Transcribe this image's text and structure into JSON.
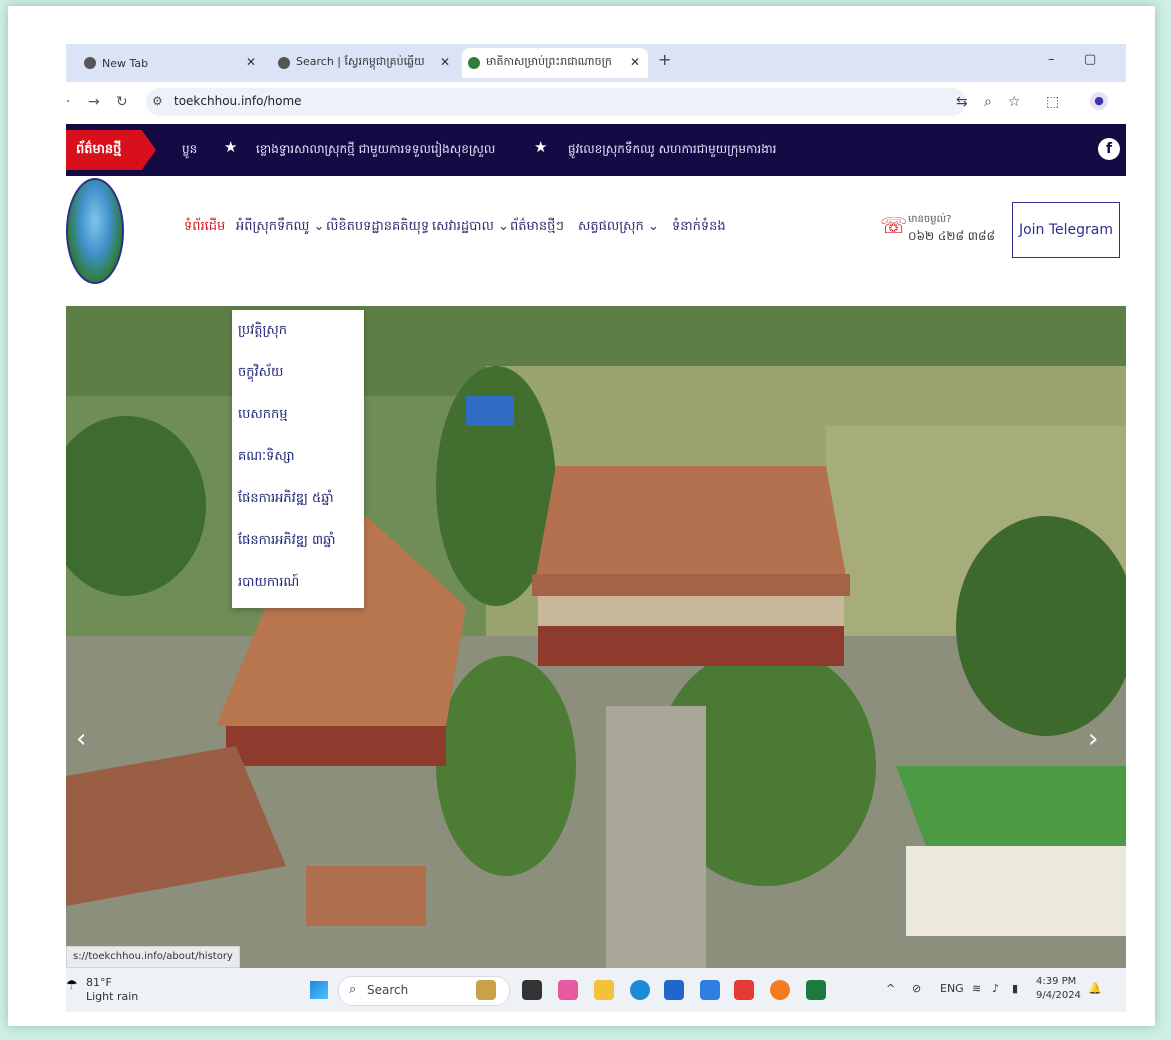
{
  "browser": {
    "tabs": [
      {
        "label": "New Tab",
        "icon": "globe-icon"
      },
      {
        "label": "Search | ស្វែរកម្ពុជាគ្រប់ឆ្លើយ",
        "icon": "globe-icon"
      },
      {
        "label": "មាតិកាសម្រាប់ព្រះរាជាណាចក្រ",
        "icon": "site-logo-icon"
      }
    ],
    "new_tab": "+",
    "url": "toekchhou.info/home",
    "status_url": "s://toekchhou.info/about/history"
  },
  "ticker": {
    "tag": "ព័ត៌មានថ្មី",
    "items": [
      "ប្លូន",
      "ខ្លោងទ្វារសាលាស្រុកថ្មី ជាមួយការទទួលរៀងសុខស្រួល",
      "ផ្លូវលេខស្រុកទឹកឈូ សហការជាមួយក្រុមការងារ"
    ],
    "facebook": "f"
  },
  "site_nav": {
    "items": [
      "ទំព័រដើម",
      "អំពីស្រុកទឹកឈូ",
      "លិខិតបទដ្ឋានគតិយុទ្ធ",
      "សេវារដ្ឋបាល",
      "ព័ត៌មានថ្មីៗ",
      "សត្វផលស្រុក",
      "ទំនាក់ទំនង"
    ],
    "chevrons": [
      "",
      "⌄",
      "",
      "⌄",
      "",
      "⌄",
      ""
    ],
    "phone_question": "មានចម្ងល់?",
    "phone_number": "០៦២ ៤២៨ ៣៨៨",
    "join": "Join Telegram"
  },
  "dropdown": {
    "items": [
      "ប្រវត្តិស្រុក",
      "ចក្ខុវិស័យ",
      "បេសកកម្ម",
      "គណៈទិស្សា",
      "ផែនការអភិវឌ្ឍ ៥ឆ្នាំ",
      "ផែនការអភិវឌ្ឍ ៣ឆ្នាំ",
      "របាយការណ៍"
    ]
  },
  "carousel": {
    "prev": "‹",
    "next": "›"
  },
  "taskbar": {
    "temp": "81°F",
    "weather": "Light rain",
    "search": "Search",
    "lang": "ENG",
    "time": "4:39 PM",
    "date": "9/4/2024"
  },
  "colors": {
    "brand": "#140b45",
    "accent": "#d8101b",
    "nav_text": "#2a2a6e"
  }
}
